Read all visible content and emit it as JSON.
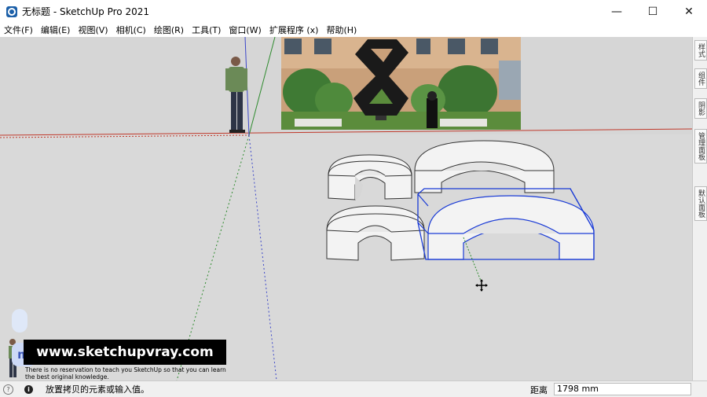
{
  "window": {
    "title": "无标题 - SketchUp Pro 2021",
    "minimize_glyph": "—",
    "maximize_glyph": "☐",
    "close_glyph": "✕"
  },
  "menu": [
    {
      "label": "文件(F)"
    },
    {
      "label": "编辑(E)"
    },
    {
      "label": "视图(V)"
    },
    {
      "label": "相机(C)"
    },
    {
      "label": "绘图(R)"
    },
    {
      "label": "工具(T)"
    },
    {
      "label": "窗口(W)"
    },
    {
      "label": "扩展程序 (x)"
    },
    {
      "label": "帮助(H)"
    }
  ],
  "tray_tabs": [
    {
      "label": "样式"
    },
    {
      "label": "组件"
    },
    {
      "label": "阴影"
    },
    {
      "label": "管理面板"
    },
    {
      "label": "默认面板"
    }
  ],
  "overlay": {
    "banner": "www.sketchupvray.com",
    "subtitle_line1": "There is no reservation to teach you SketchUp so that you can learn",
    "subtitle_line2": "the best original knowledge.",
    "m_badge": "m"
  },
  "status": {
    "message": "放置拷贝的元素或输入值。",
    "measurement_label": "距离",
    "measurement_value": "1798 mm"
  },
  "colors": {
    "selection": "#1a3bd6",
    "red_axis": "#c0392b",
    "green_axis": "#2e8b2e",
    "blue_axis": "#3b46c9"
  },
  "icons": [
    "sketchup-app-icon",
    "help-icon",
    "info-icon",
    "move-cursor-icon"
  ]
}
